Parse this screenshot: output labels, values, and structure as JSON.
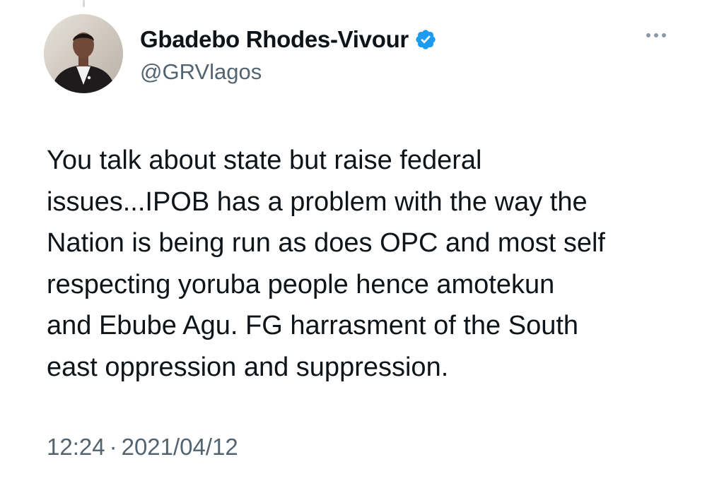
{
  "author": {
    "display_name": "Gbadebo Rhodes-Vivour",
    "handle": "@GRVlagos",
    "verified": true,
    "avatar_icon": "profile-photo",
    "badge_color": "#1d9bf0"
  },
  "tweet": {
    "text_lines": [
      "You talk about state but raise federal",
      "issues...IPOB has a problem with the way the",
      "Nation is being run as does OPC and most self",
      "respecting yoruba people hence amotekun",
      "and Ebube Agu. FG harrasment of the South",
      "east oppression and suppression."
    ],
    "time": "12:24",
    "separator": "·",
    "date": "2021/04/12"
  },
  "menu": {
    "icon": "more-horizontal-icon"
  },
  "colors": {
    "text_primary": "#0f1419",
    "text_secondary": "#536471",
    "verified_blue": "#1d9bf0"
  }
}
